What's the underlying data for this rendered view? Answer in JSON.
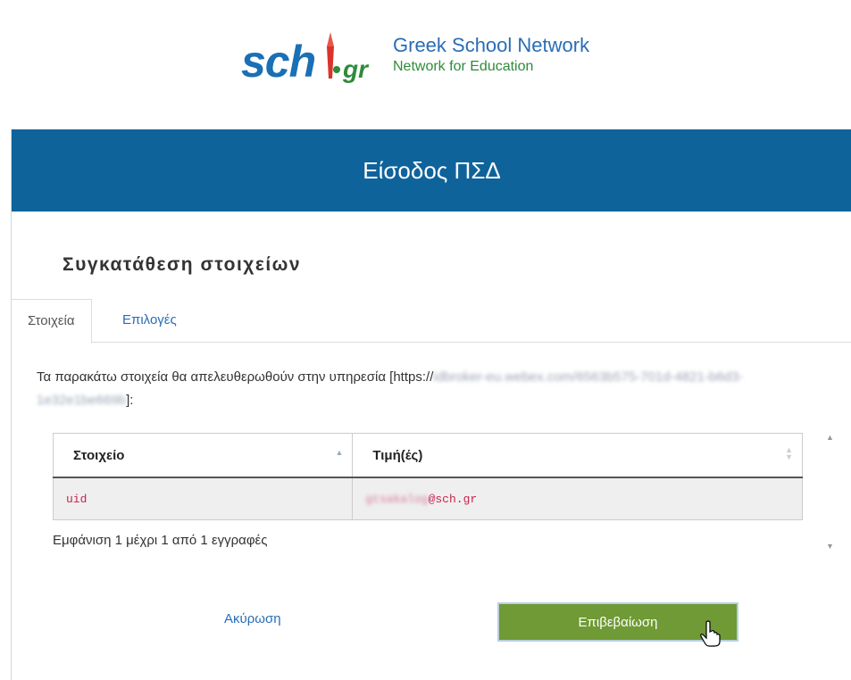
{
  "logo": {
    "wordmark": "sch",
    "suffix": "gr",
    "title": "Greek School Network",
    "subtitle": "Network for Education"
  },
  "header": {
    "title": "Είσοδος ΠΣΔ"
  },
  "section": {
    "title": "Συγκατάθεση στοιχείων"
  },
  "tabs": [
    {
      "label": "Στοιχεία",
      "active": true
    },
    {
      "label": "Επιλογές",
      "active": false
    }
  ],
  "description": {
    "prefix": "Τα παρακάτω στοιχεία θα απελευθερωθούν στην υπηρεσία [https://",
    "url_blurred": "idbroker-eu.webex.com/6563b575-701d-4821-b6d3-1e32e1be669b",
    "suffix": "]:"
  },
  "table": {
    "headers": [
      "Στοιχείο",
      "Τιμή(ές)"
    ],
    "rows": [
      {
        "attribute": "uid",
        "value_blurred": "gtsakalog",
        "value_suffix": "@sch.gr"
      }
    ]
  },
  "info": "Εμφάνιση 1 μέχρι 1 από 1 εγγραφές",
  "buttons": {
    "cancel": "Ακύρωση",
    "confirm": "Επιβεβαίωση"
  },
  "colors": {
    "header_bg": "#0f639b",
    "confirm_bg": "#6f9a35",
    "link": "#2a6db5"
  }
}
